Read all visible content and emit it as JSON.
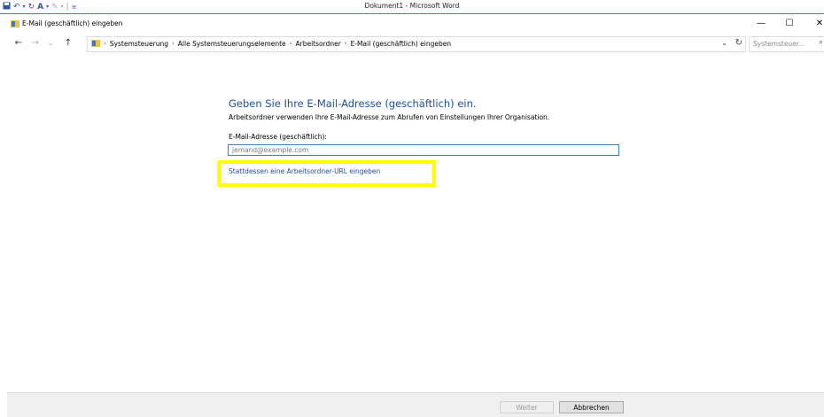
{
  "word": {
    "title": "Dokument1 - Microsoft Word"
  },
  "window": {
    "title": "E-Mail (geschäftlich) eingeben",
    "minimize": "—",
    "maximize": "☐",
    "close": "✕"
  },
  "nav": {
    "back": "←",
    "forward": "→",
    "recent": "⌄",
    "up": "↑"
  },
  "address": {
    "breadcrumbs": [
      "Systemsteuerung",
      "Alle Systemsteuerungselemente",
      "Arbeitsordner",
      "E-Mail (geschäftlich) eingeben"
    ],
    "dropdown": "⌄",
    "refresh": "↻"
  },
  "search": {
    "placeholder": "Systemsteuer...",
    "icon": "⌕"
  },
  "main": {
    "heading": "Geben Sie Ihre E-Mail-Adresse (geschäftlich) ein.",
    "description": "Arbeitsordner verwenden Ihre E-Mail-Adresse zum Abrufen von Einstellungen Ihrer Organisation.",
    "field_label": "E-Mail-Adresse (geschäftlich):",
    "email_placeholder": "jemand@example.com",
    "email_value": "",
    "alt_link": "Stattdessen eine Arbeitsordner-URL eingeben"
  },
  "footer": {
    "next_label": "Weiter",
    "cancel_label": "Abbrechen"
  },
  "colors": {
    "link": "#1e4e9b",
    "highlight": "#ffff00",
    "word_accent": "#2f9e63"
  }
}
